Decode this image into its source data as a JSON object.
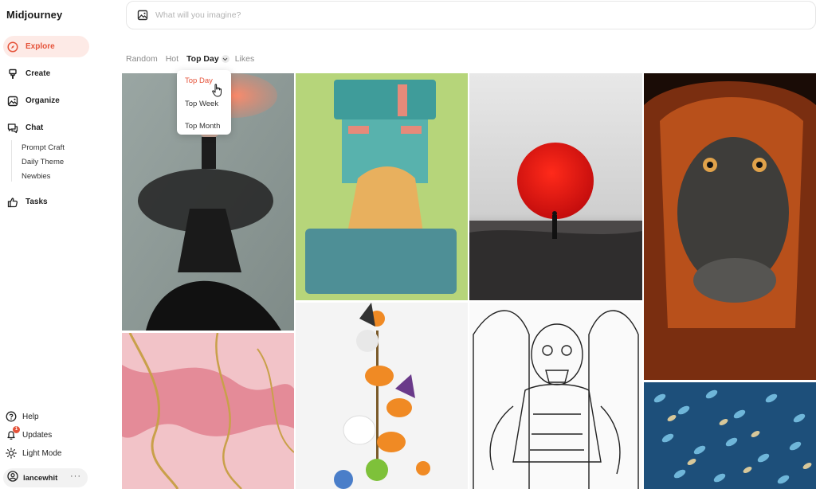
{
  "app": {
    "title": "Midjourney"
  },
  "sidebar": {
    "items": [
      {
        "label": "Explore",
        "icon": "compass-icon"
      },
      {
        "label": "Create",
        "icon": "brush-icon"
      },
      {
        "label": "Organize",
        "icon": "image-icon"
      },
      {
        "label": "Chat",
        "icon": "chat-icon"
      },
      {
        "label": "Tasks",
        "icon": "thumbs-up-icon"
      }
    ],
    "chat_rooms": [
      "Prompt Craft",
      "Daily Theme",
      "Newbies"
    ],
    "bottom": {
      "help": "Help",
      "updates": "Updates",
      "updates_badge": "1",
      "light_mode": "Light Mode",
      "username": "lancewhit",
      "more": "···"
    }
  },
  "search": {
    "placeholder": "What will you imagine?",
    "value": ""
  },
  "tabs": [
    "Random",
    "Hot",
    "Top Day",
    "Likes"
  ],
  "active_tab": "Top Day",
  "dropdown": {
    "options": [
      "Top Day",
      "Top Week",
      "Top Month"
    ],
    "selected": "Top Day"
  },
  "gallery": {
    "images": [
      "woman-in-black-tulle-dress",
      "stone-head-figure-green",
      "red-sun-desert-figure",
      "orangutan-portrait",
      "pink-gold-marble",
      "halloween-pumpkin-stack",
      "zombie-line-art",
      "blue-feather-mosaic"
    ]
  },
  "colors": {
    "accent": "#e5533a",
    "active_bg": "#fdeae6",
    "muted_text": "#8a8a8a"
  }
}
